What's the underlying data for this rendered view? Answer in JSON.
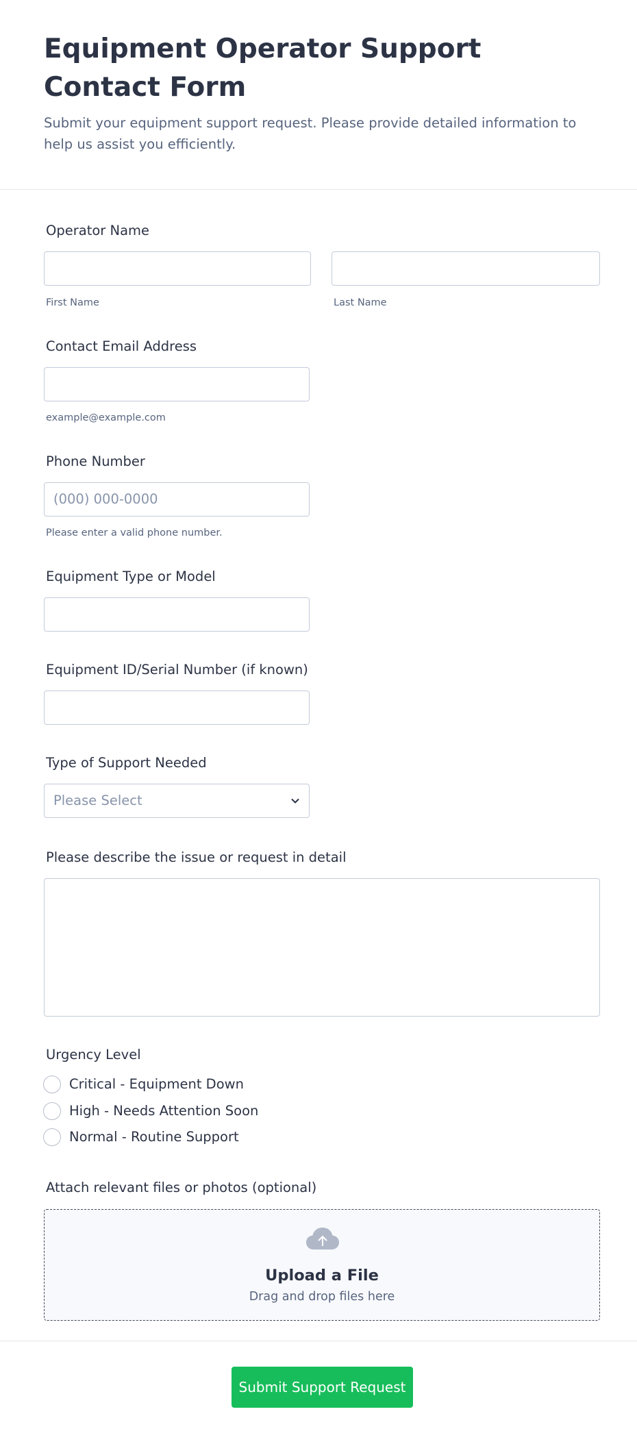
{
  "header": {
    "title": "Equipment Operator Support Contact Form",
    "subtitle": "Submit your equipment support request. Please provide detailed information to help us assist you efficiently."
  },
  "form": {
    "operator_name": {
      "label": "Operator Name",
      "first_value": "",
      "last_value": "",
      "first_sublabel": "First Name",
      "last_sublabel": "Last Name"
    },
    "email": {
      "label": "Contact Email Address",
      "value": "",
      "sublabel": "example@example.com"
    },
    "phone": {
      "label": "Phone Number",
      "placeholder": "(000) 000-0000",
      "value": "",
      "sublabel": "Please enter a valid phone number."
    },
    "equipment_type": {
      "label": "Equipment Type or Model",
      "value": ""
    },
    "equipment_id": {
      "label": "Equipment ID/Serial Number (if known)",
      "value": ""
    },
    "support_type": {
      "label": "Type of Support Needed",
      "selected": "Please Select"
    },
    "description": {
      "label": "Please describe the issue or request in detail",
      "value": ""
    },
    "urgency": {
      "label": "Urgency Level",
      "options": [
        {
          "label": "Critical - Equipment Down",
          "checked": false
        },
        {
          "label": "High - Needs Attention Soon",
          "checked": false
        },
        {
          "label": "Normal - Routine Support",
          "checked": false
        }
      ]
    },
    "attachments": {
      "label": "Attach relevant files or photos (optional)",
      "upload_title": "Upload a File",
      "upload_hint": "Drag and drop files here",
      "icon": "cloud-upload-icon"
    },
    "submit_label": "Submit Support Request"
  },
  "colors": {
    "submit_button": "#18bd5b",
    "text_primary": "#2c3345",
    "text_secondary": "#57647e",
    "input_border": "#c3cad8",
    "placeholder": "#8894ab",
    "upload_background": "#f8f9fc",
    "icon_gray": "#b0b8c8"
  }
}
